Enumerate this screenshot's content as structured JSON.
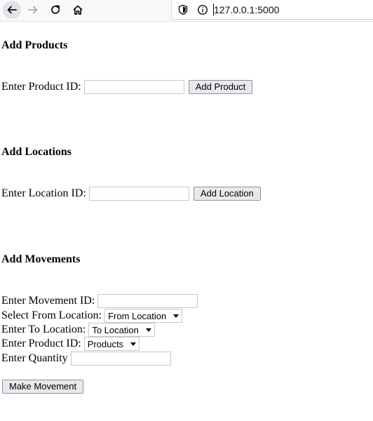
{
  "browser": {
    "url": "127.0.0.1:5000",
    "icons": {
      "back": "back-arrow-icon",
      "forward": "forward-arrow-icon",
      "reload": "reload-icon",
      "home": "home-icon",
      "shield": "shield-icon",
      "info": "info-icon"
    }
  },
  "products": {
    "heading": "Add Products",
    "id_label": "Enter Product ID:",
    "id_value": "",
    "button": "Add Product"
  },
  "locations": {
    "heading": "Add Locations",
    "id_label": "Enter Location ID:",
    "id_value": "",
    "button": "Add Location"
  },
  "movements": {
    "heading": "Add Movements",
    "id_label": "Enter Movement ID:",
    "id_value": "",
    "from_label": "Select From Location:",
    "from_selected": "From Location",
    "to_label": "Enter To Location:",
    "to_selected": "To Location",
    "product_label": "Enter Product ID:",
    "product_selected": "Products",
    "quantity_label": "Enter Quantity",
    "quantity_value": "",
    "button": "Make Movement"
  }
}
